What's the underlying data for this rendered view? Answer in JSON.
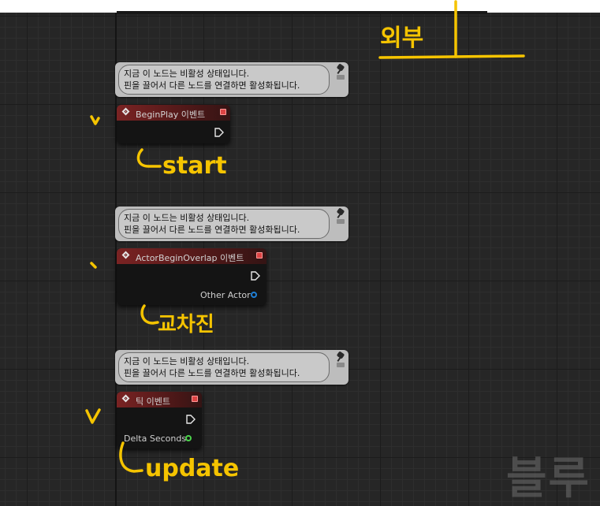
{
  "comment_bubbles": [
    {
      "line1": "지금 이 노드는 비활성 상태입니다.",
      "line2": "핀을 끌어서 다른 노드를 연결하면 활성화됩니다."
    },
    {
      "line1": "지금 이 노드는 비활성 상태입니다.",
      "line2": "핀을 끌어서 다른 노드를 연결하면 활성화됩니다."
    },
    {
      "line1": "지금 이 노드는 비활성 상태입니다.",
      "line2": "핀을 끌어서 다른 노드를 연결하면 활성화됩니다."
    }
  ],
  "nodes": [
    {
      "title": "BeginPlay 이벤트",
      "pins": []
    },
    {
      "title": "ActorBeginOverlap 이벤트",
      "pins": [
        {
          "label": "Other Actor",
          "color": "#1f7fd6"
        }
      ]
    },
    {
      "title": "틱 이벤트",
      "pins": [
        {
          "label": "Delta Seconds",
          "color": "#4bd34b"
        }
      ]
    }
  ],
  "annotations": {
    "top": "외부",
    "start": "start",
    "overlap": "교차진",
    "update": "update"
  },
  "watermark": "블루",
  "colors": {
    "handwriting": "#f5c400",
    "node_header": "#7a2323",
    "comment_bg": "#bdbdbd",
    "canvas_bg": "#262626"
  }
}
